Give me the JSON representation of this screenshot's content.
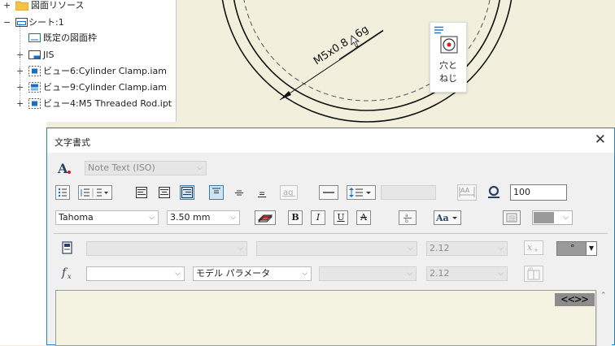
{
  "browser": {
    "items": [
      {
        "expander": "+",
        "label": "図面リソース"
      },
      {
        "expander": "−",
        "label": "シート:1"
      },
      {
        "expander": "",
        "label": "既定の図面枠"
      },
      {
        "expander": "+",
        "label": "JIS"
      },
      {
        "expander": "+",
        "label": "ビュー6:Cylinder Clamp.iam"
      },
      {
        "expander": "+",
        "label": "ビュー9:Cylinder Clamp.iam"
      },
      {
        "expander": "+",
        "label": "ビュー4:M5 Threaded Rod.ipt"
      }
    ]
  },
  "canvas": {
    "dimension_text": "M5x0.8 - 6g",
    "popup_label_line1": "穴と",
    "popup_label_line2": "ねじ"
  },
  "dialog": {
    "title": "文字書式",
    "close_glyph": "✕",
    "style_value": "Note Text (ISO)",
    "stretch_value": "100",
    "font_value": "Tahoma",
    "font_size_value": "3.50 mm",
    "precision_value_1": "2.12",
    "precision_value_2": "2.12",
    "symbol_value": "°",
    "parameter_type": "モデル パラメータ",
    "text_content": "<<>>",
    "colors": {
      "accent": "#1883d7",
      "link_text_bg": "#8c8c8c"
    }
  }
}
